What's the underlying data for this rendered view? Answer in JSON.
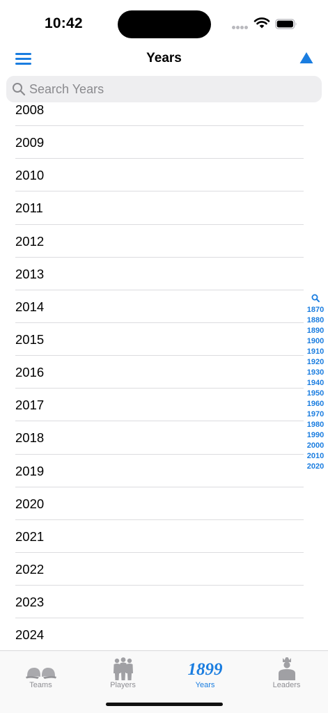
{
  "status_bar": {
    "time": "10:42"
  },
  "nav_bar": {
    "title": "Years",
    "menu_icon": "hamburger-menu-icon",
    "sort_icon": "triangle-up-icon"
  },
  "search": {
    "placeholder": "Search Years",
    "value": ""
  },
  "years_list": {
    "partial_top_row": "2008",
    "items": [
      "2009",
      "2010",
      "2011",
      "2012",
      "2013",
      "2014",
      "2015",
      "2016",
      "2017",
      "2018",
      "2019",
      "2020",
      "2021",
      "2022",
      "2023",
      "2024"
    ]
  },
  "section_index": {
    "search_icon": "magnifier-icon",
    "items": [
      "1870",
      "1880",
      "1890",
      "1900",
      "1910",
      "1920",
      "1930",
      "1940",
      "1950",
      "1960",
      "1970",
      "1980",
      "1990",
      "2000",
      "2010",
      "2020"
    ]
  },
  "tab_bar": {
    "tabs": [
      {
        "label": "Teams",
        "icon": "baseball-caps-icon",
        "active": false
      },
      {
        "label": "Players",
        "icon": "players-silhouette-icon",
        "active": false
      },
      {
        "label": "Years",
        "icon_text": "1899",
        "active": true
      },
      {
        "label": "Leaders",
        "icon": "leader-silhouette-icon",
        "active": false
      }
    ]
  },
  "colors": {
    "accent": "#1a7de0",
    "separator": "#dcdcdf",
    "search_background": "#eeeef0",
    "tab_inactive": "#8e8e93"
  }
}
